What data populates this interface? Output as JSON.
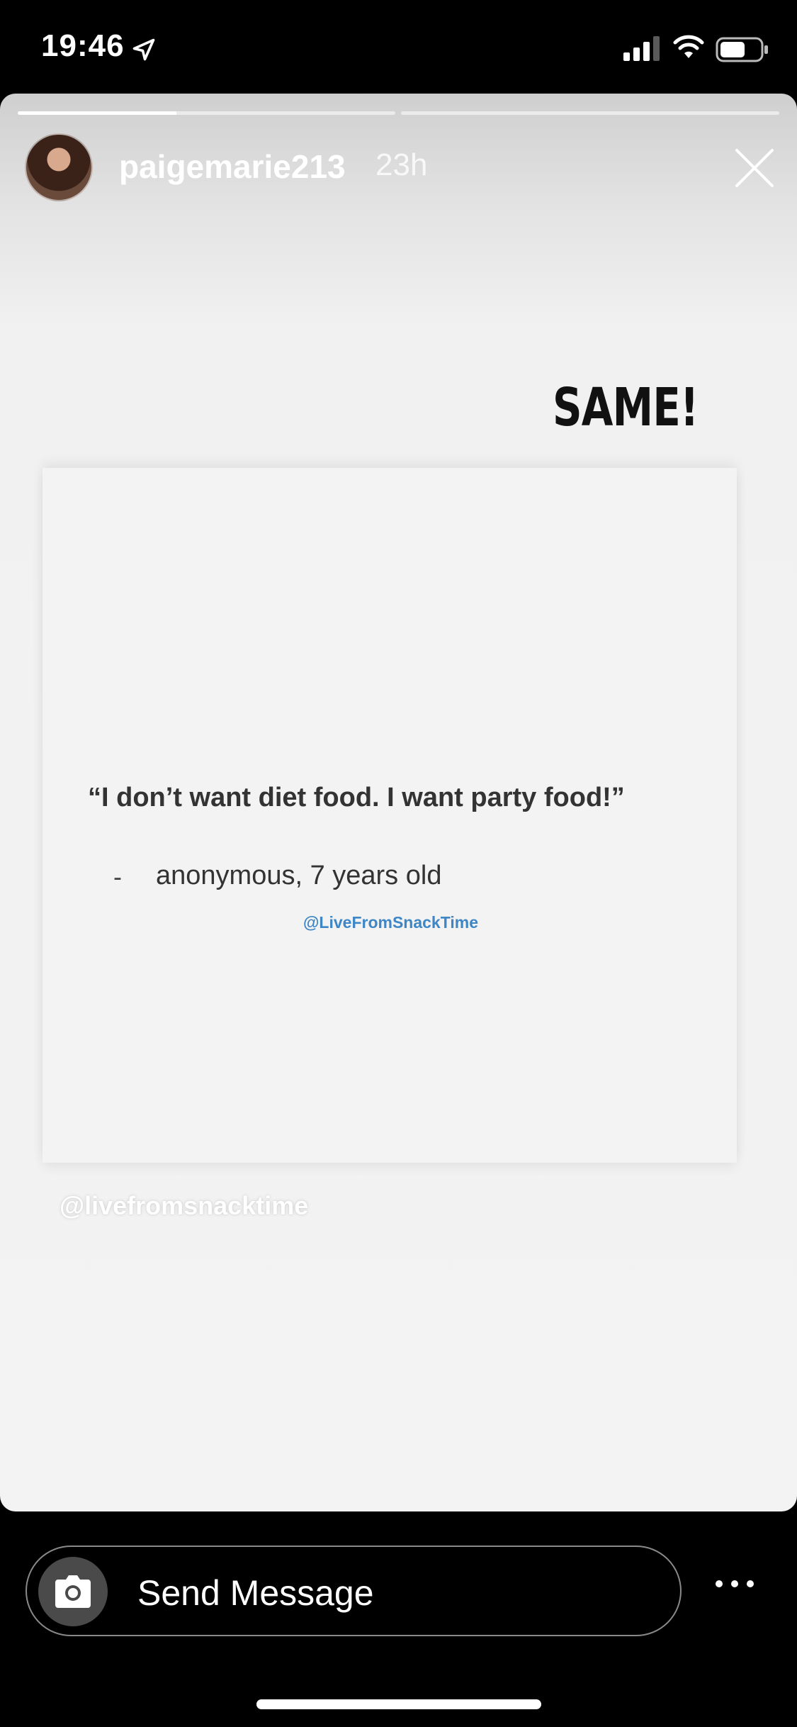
{
  "status_bar": {
    "time": "19:46",
    "icons": [
      "location-arrow-icon",
      "signal-icon",
      "wifi-icon",
      "battery-icon"
    ]
  },
  "story": {
    "progress": [
      0.42,
      0.0
    ],
    "username": "paigemarie213",
    "time_ago": "23h",
    "close_icon": "close-icon",
    "sticker_text": "SAME!",
    "quote": "“I don’t want diet food. I want party food!”",
    "attribution_dash": "-",
    "attribution": "anonymous, 7 years old",
    "card_handle": "@LiveFromSnackTime",
    "watermark": "@livefromsnacktime"
  },
  "message_bar": {
    "placeholder": "Send Message",
    "camera_icon": "camera-icon",
    "more_icon": "more-icon"
  },
  "colors": {
    "handle_blue": "#3f86c6",
    "background": "#000000",
    "story_background": "#f3f3f3"
  }
}
